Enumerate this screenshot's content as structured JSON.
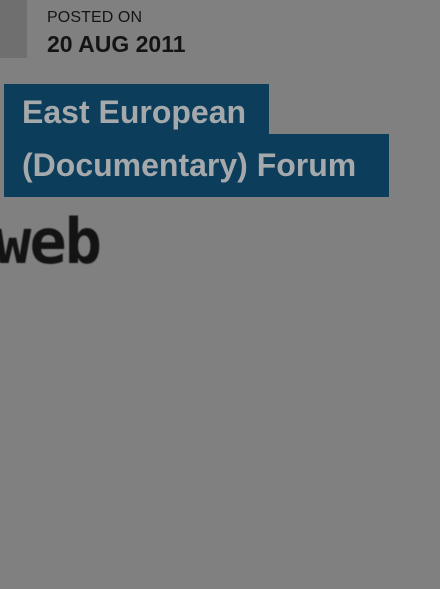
{
  "post": {
    "posted_label": "POSTED ON",
    "posted_date": "20 AUG 2011",
    "title_line1": "East European",
    "title_line2": "(Documentary) Forum"
  },
  "thumbnail": {
    "text": "web"
  },
  "colors": {
    "background": "#808080",
    "title_bg": "#0c3e5c",
    "title_text": "#a6a9ab",
    "date_text": "#141414"
  }
}
